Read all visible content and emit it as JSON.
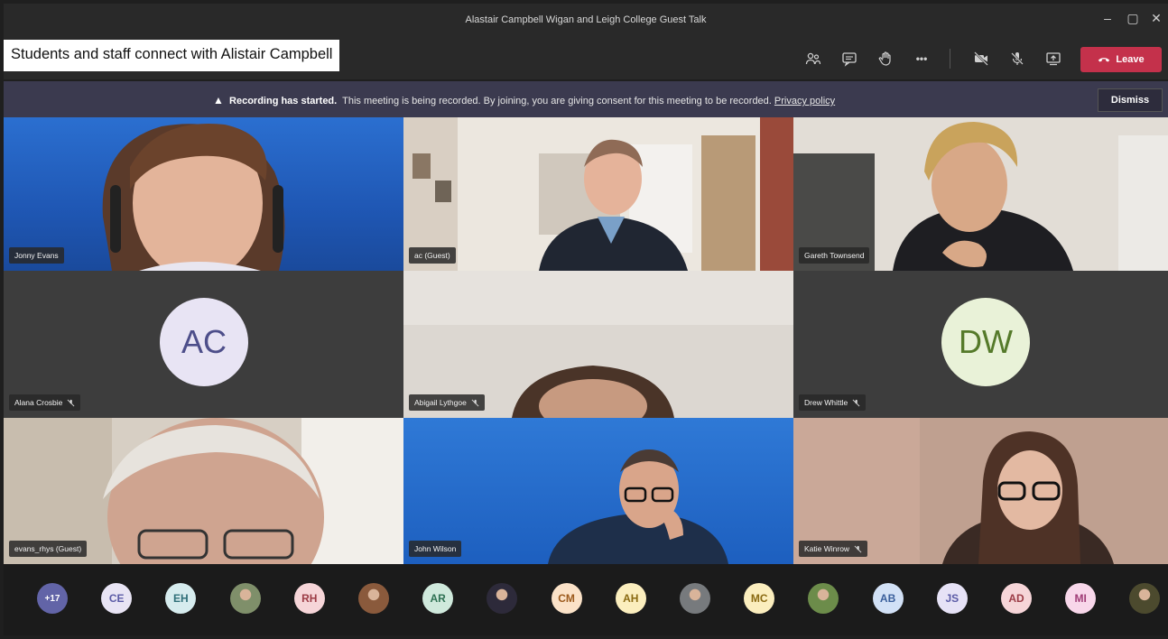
{
  "window": {
    "title": "Alastair Campbell Wigan and Leigh College Guest Talk",
    "minimize_glyph": "–",
    "maximize_glyph": "▢",
    "close_glyph": "✕"
  },
  "caption": "Students and staff connect with Alistair Campbell",
  "toolbar": {
    "icons": [
      "participants-icon",
      "chat-icon",
      "raise-hand-icon",
      "more-icon",
      "camera-off-icon",
      "mic-off-icon",
      "share-screen-icon"
    ],
    "more_label": "•••",
    "leave_label": "Leave",
    "leave_color": "#c4314b"
  },
  "banner": {
    "title": "Recording has started.",
    "message": "This meeting is being recorded. By joining, you are giving consent for this meeting to be recorded.",
    "link": "Privacy policy",
    "dismiss_label": "Dismiss"
  },
  "tiles": [
    {
      "name": "Jonny Evans",
      "muted": false
    },
    {
      "name": "ac (Guest)",
      "muted": false
    },
    {
      "name": "Gareth Townsend",
      "muted": false
    },
    {
      "name": "Alana Crosbie",
      "muted": true,
      "avatar": "AC"
    },
    {
      "name": "Abigail Lythgoe",
      "muted": true
    },
    {
      "name": "Drew Whittle",
      "muted": true,
      "avatar": "DW"
    },
    {
      "name": "evans_rhys (Guest)",
      "muted": false
    },
    {
      "name": "John Wilson",
      "muted": false
    },
    {
      "name": "Katie Winrow",
      "muted": true
    }
  ],
  "participants": [
    {
      "label": "+17",
      "bg": "#6264a7",
      "fg": "#ffffff"
    },
    {
      "label": "CE",
      "bg": "#e8e4f4",
      "fg": "#5b5ba6"
    },
    {
      "label": "EH",
      "bg": "#d6ecee",
      "fg": "#2f6f78"
    },
    {
      "label": "",
      "bg": "#7f8f6a",
      "fg": "#ffffff"
    },
    {
      "label": "RH",
      "bg": "#f6d5d8",
      "fg": "#9c3c46"
    },
    {
      "label": "",
      "bg": "#8a5a3c",
      "fg": "#ffffff"
    },
    {
      "label": "AR",
      "bg": "#cfe9dc",
      "fg": "#2e7153"
    },
    {
      "label": "",
      "bg": "#2d2a3a",
      "fg": "#ffffff"
    },
    {
      "label": "CM",
      "bg": "#fbe2c8",
      "fg": "#9c5a1d"
    },
    {
      "label": "AH",
      "bg": "#fbeebe",
      "fg": "#8a6a12"
    },
    {
      "label": "",
      "bg": "#777a7d",
      "fg": "#ffffff"
    },
    {
      "label": "MC",
      "bg": "#fbeebe",
      "fg": "#8a6a12"
    },
    {
      "label": "",
      "bg": "#6c8c4a",
      "fg": "#ffffff"
    },
    {
      "label": "AB",
      "bg": "#d2e1f6",
      "fg": "#3a5f9b"
    },
    {
      "label": "JS",
      "bg": "#e6e2f6",
      "fg": "#5b5ba6"
    },
    {
      "label": "AD",
      "bg": "#f6d5d8",
      "fg": "#9c3c46"
    },
    {
      "label": "MI",
      "bg": "#f8d7ea",
      "fg": "#a03d77"
    },
    {
      "label": "",
      "bg": "#4c4a2e",
      "fg": "#ffffff"
    }
  ]
}
